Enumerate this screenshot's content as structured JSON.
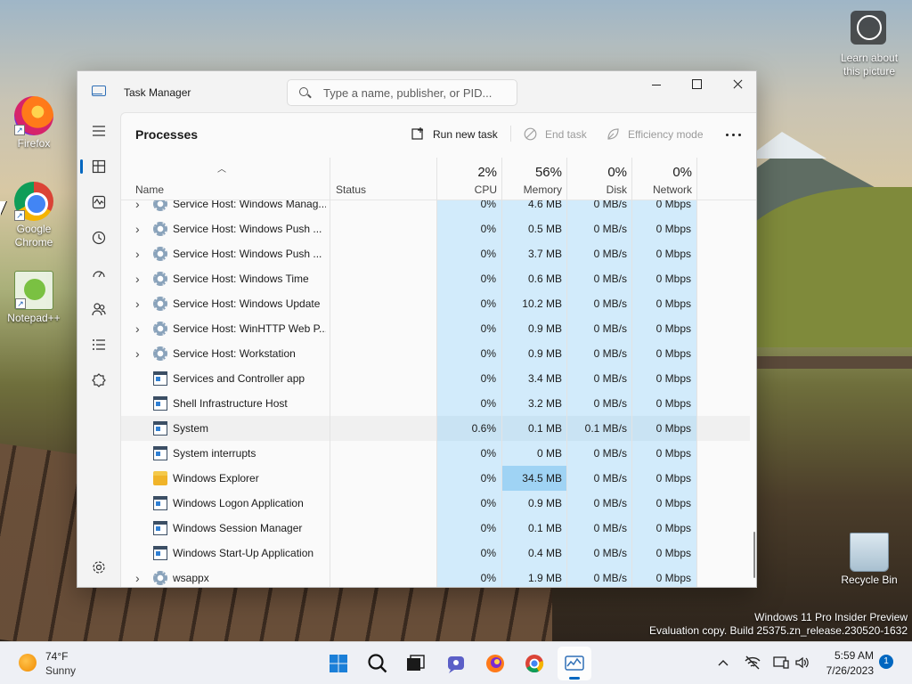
{
  "desktop": {
    "icons": [
      {
        "label": "Firefox"
      },
      {
        "label": "Google Chrome"
      },
      {
        "label": "Notepad++"
      },
      {
        "label": "Recycle Bin"
      }
    ],
    "learn_picture": "Learn about this picture",
    "watermark_line1": "Windows 11 Pro Insider Preview",
    "watermark_line2": "Evaluation copy. Build 25375.zn_release.230520-1632"
  },
  "window": {
    "title": "Task Manager",
    "search_placeholder": "Type a name, publisher, or PID..."
  },
  "nav": {
    "items": [
      "menu-icon",
      "processes-icon",
      "performance-icon",
      "app-history-icon",
      "startup-apps-icon",
      "users-icon",
      "details-icon",
      "services-icon",
      "settings-icon"
    ],
    "active": "processes"
  },
  "toolbar": {
    "page_title": "Processes",
    "run_new_task": "Run new task",
    "end_task": "End task",
    "efficiency_mode": "Efficiency mode"
  },
  "columns": {
    "name": "Name",
    "status": "Status",
    "cpu_label": "CPU",
    "cpu_pct": "2%",
    "memory_label": "Memory",
    "memory_pct": "56%",
    "disk_label": "Disk",
    "disk_pct": "0%",
    "network_label": "Network",
    "network_pct": "0%"
  },
  "rows": [
    {
      "name": "Service Host: Windows Manag...",
      "icon": "gear",
      "expand": true,
      "cpu": "0%",
      "memory": "4.6 MB",
      "disk": "0 MB/s",
      "network": "0 Mbps"
    },
    {
      "name": "Service Host: Windows Push ...",
      "icon": "gear",
      "expand": true,
      "cpu": "0%",
      "memory": "0.5 MB",
      "disk": "0 MB/s",
      "network": "0 Mbps"
    },
    {
      "name": "Service Host: Windows Push ...",
      "icon": "gear",
      "expand": true,
      "cpu": "0%",
      "memory": "3.7 MB",
      "disk": "0 MB/s",
      "network": "0 Mbps"
    },
    {
      "name": "Service Host: Windows Time",
      "icon": "gear",
      "expand": true,
      "cpu": "0%",
      "memory": "0.6 MB",
      "disk": "0 MB/s",
      "network": "0 Mbps"
    },
    {
      "name": "Service Host: Windows Update",
      "icon": "gear",
      "expand": true,
      "cpu": "0%",
      "memory": "10.2 MB",
      "disk": "0 MB/s",
      "network": "0 Mbps"
    },
    {
      "name": "Service Host: WinHTTP Web P...",
      "icon": "gear",
      "expand": true,
      "cpu": "0%",
      "memory": "0.9 MB",
      "disk": "0 MB/s",
      "network": "0 Mbps"
    },
    {
      "name": "Service Host: Workstation",
      "icon": "gear",
      "expand": true,
      "cpu": "0%",
      "memory": "0.9 MB",
      "disk": "0 MB/s",
      "network": "0 Mbps"
    },
    {
      "name": "Services and Controller app",
      "icon": "window",
      "expand": false,
      "cpu": "0%",
      "memory": "3.4 MB",
      "disk": "0 MB/s",
      "network": "0 Mbps"
    },
    {
      "name": "Shell Infrastructure Host",
      "icon": "window",
      "expand": false,
      "cpu": "0%",
      "memory": "3.2 MB",
      "disk": "0 MB/s",
      "network": "0 Mbps"
    },
    {
      "name": "System",
      "icon": "window",
      "expand": false,
      "highlight": true,
      "cpu": "0.6%",
      "memory": "0.1 MB",
      "disk": "0.1 MB/s",
      "network": "0 Mbps"
    },
    {
      "name": "System interrupts",
      "icon": "window",
      "expand": false,
      "cpu": "0%",
      "memory": "0 MB",
      "disk": "0 MB/s",
      "network": "0 Mbps"
    },
    {
      "name": "Windows Explorer",
      "icon": "folder",
      "expand": false,
      "hot_memory": true,
      "cpu": "0%",
      "memory": "34.5 MB",
      "disk": "0 MB/s",
      "network": "0 Mbps"
    },
    {
      "name": "Windows Logon Application",
      "icon": "window",
      "expand": false,
      "cpu": "0%",
      "memory": "0.9 MB",
      "disk": "0 MB/s",
      "network": "0 Mbps"
    },
    {
      "name": "Windows Session Manager",
      "icon": "window",
      "expand": false,
      "cpu": "0%",
      "memory": "0.1 MB",
      "disk": "0 MB/s",
      "network": "0 Mbps"
    },
    {
      "name": "Windows Start-Up Application",
      "icon": "window",
      "expand": false,
      "cpu": "0%",
      "memory": "0.4 MB",
      "disk": "0 MB/s",
      "network": "0 Mbps"
    },
    {
      "name": "wsappx",
      "icon": "gear",
      "expand": true,
      "cpu": "0%",
      "memory": "1.9 MB",
      "disk": "0 MB/s",
      "network": "0 Mbps"
    }
  ],
  "taskbar": {
    "weather_temp": "74°F",
    "weather_condition": "Sunny",
    "apps": [
      "start-icon",
      "search-icon",
      "task-view-icon",
      "chat-icon",
      "firefox-icon",
      "chrome-icon",
      "task-manager-icon"
    ],
    "time": "5:59 AM",
    "date": "7/26/2023",
    "notification_count": "1"
  },
  "colors": {
    "accent": "#0067c0",
    "column_heat": "#d2ebfb",
    "column_heat_strong": "#9fd3f4"
  }
}
